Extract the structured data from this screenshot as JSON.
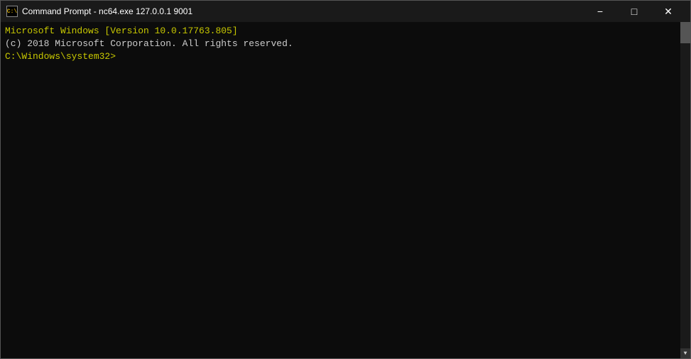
{
  "titleBar": {
    "icon": "C:\\",
    "title": "Command Prompt - nc64.exe  127.0.0.1 9001",
    "minimize": "−",
    "maximize": "□",
    "close": "✕"
  },
  "console": {
    "line1": "Microsoft Windows [Version 10.0.17763.805]",
    "line2": "(c) 2018 Microsoft Corporation. All rights reserved.",
    "line3": "",
    "line4": "C:\\Windows\\system32>"
  }
}
